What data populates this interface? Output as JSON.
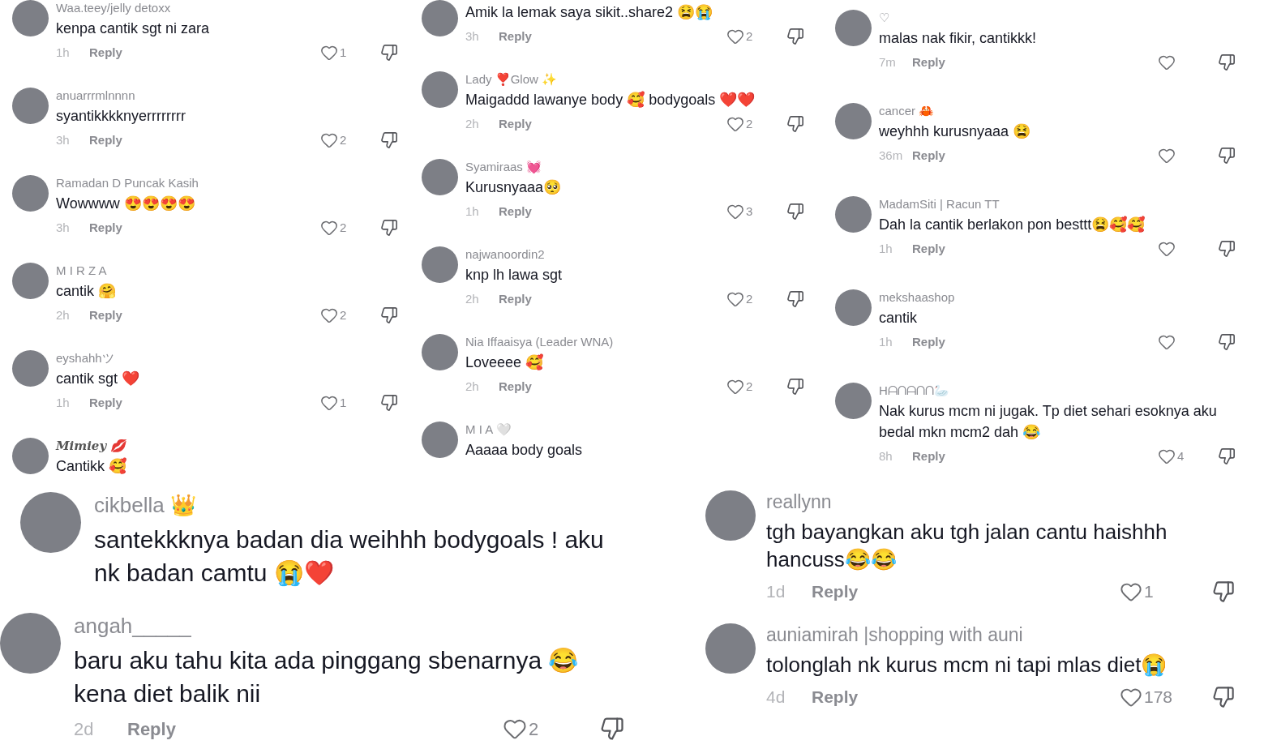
{
  "top_panels": [
    {
      "comments": [
        {
          "user": "Waa.teey/jelly detoxx",
          "text": "kenpa cantik sgt ni zara",
          "time": "1h",
          "reply": "Reply",
          "likes": "1"
        },
        {
          "user": "anuarrrmlnnnn",
          "text": "syantikkkknyerrrrrrrr",
          "time": "3h",
          "reply": "Reply",
          "likes": "2"
        },
        {
          "user": "Ramadan D Puncak Kasih",
          "text": "Wowwww 😍😍😍😍",
          "time": "3h",
          "reply": "Reply",
          "likes": "2"
        },
        {
          "user": "M I R Z A",
          "text": "cantik 🤗",
          "time": "2h",
          "reply": "Reply",
          "likes": "2"
        },
        {
          "user": "eyshahhツ",
          "text": "cantik sgt ❤️",
          "time": "1h",
          "reply": "Reply",
          "likes": "1"
        },
        {
          "user": "Mimiey 💋",
          "kind": "script",
          "text": "Cantikk 🥰"
        }
      ]
    },
    {
      "comments": [
        {
          "text": "Amik la lemak saya sikit..share2 😫😭",
          "time": "3h",
          "reply": "Reply",
          "likes": "2"
        },
        {
          "user": "Lady ❣️Glow ✨",
          "text": "Maigaddd lawanye body 🥰 bodygoals ❤️❤️",
          "time": "2h",
          "reply": "Reply",
          "likes": "2"
        },
        {
          "user": "Syamiraas 💓",
          "text": "Kurusnyaaa🥺",
          "time": "1h",
          "reply": "Reply",
          "likes": "3"
        },
        {
          "user": "najwanoordin2",
          "text": "knp lh lawa sgt",
          "time": "2h",
          "reply": "Reply",
          "likes": "2"
        },
        {
          "user": "Nia Iffaaisya (Leader WNA)",
          "text": "Loveeee 🥰",
          "time": "2h",
          "reply": "Reply",
          "likes": "2"
        },
        {
          "user": "M I A 🤍",
          "text": "Aaaaa body goals"
        }
      ]
    },
    {
      "comments": [
        {
          "user": "♡",
          "text": "malas nak fikir, cantikkk!",
          "time": "7m",
          "reply": "Reply"
        },
        {
          "user": "cancer 🦀",
          "text": "weyhhh kurusnyaaa 😫",
          "time": "36m",
          "reply": "Reply"
        },
        {
          "user": "MadamSiti | Racun TT",
          "text": "Dah la cantik berlakon pon besttt😫🥰🥰",
          "time": "1h",
          "reply": "Reply"
        },
        {
          "user": "mekshaashop",
          "text": "cantik",
          "time": "1h",
          "reply": "Reply"
        },
        {
          "user": "Hᗩᑎᗩᑎᑎ🦢",
          "text": "Nak kurus mcm ni jugak. Tp diet sehari esoknya aku bedal mkn mcm2 dah 😂",
          "time": "8h",
          "reply": "Reply",
          "likes": "4"
        }
      ]
    }
  ],
  "bottom_columns": [
    [
      {
        "comments": [
          {
            "user": "cikbella 👑",
            "text": "santekkknya badan dia weihhh bodygoals ! aku nk badan camtu 😭❤️"
          }
        ]
      },
      {
        "comments": [
          {
            "user": "angah_____",
            "text": "baru aku tahu kita ada pinggang sbenarnya 😂 kena diet balik nii",
            "time": "2d",
            "reply": "Reply",
            "likes": "2"
          }
        ]
      }
    ],
    [
      {
        "comments": [
          {
            "user": "reallynn",
            "text": "tgh bayangkan aku tgh jalan cantu haishhh hancuss😂😂",
            "time": "1d",
            "reply": "Reply",
            "likes": "1"
          },
          {
            "user": "auniamirah |shopping with auni",
            "text": "tolonglah nk kurus mcm ni tapi mlas diet😭",
            "time": "4d",
            "reply": "Reply",
            "likes": "178"
          }
        ]
      }
    ]
  ]
}
